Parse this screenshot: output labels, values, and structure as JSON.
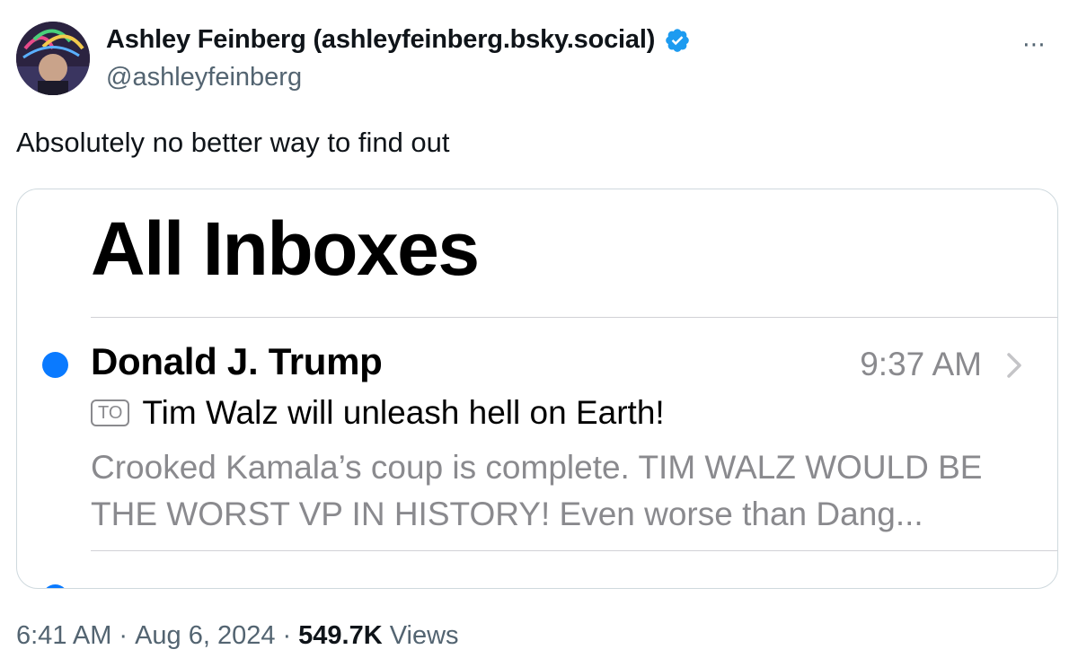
{
  "author": {
    "display_name": "Ashley Feinberg (ashleyfeinberg.bsky.social)",
    "handle": "@ashleyfeinberg",
    "verified_color": "#1d9bf0"
  },
  "more_icon": "⋯",
  "tweet": {
    "text": "Absolutely no better way to find out"
  },
  "media": {
    "title": "All Inboxes",
    "emails": [
      {
        "sender": "Donald J. Trump",
        "time": "9:37 AM",
        "to_badge": "TO",
        "subject": "Tim Walz will unleash hell on Earth!",
        "preview": "Crooked Kamala’s coup is complete. TIM WALZ WOULD BE THE WORST VP IN HISTORY! Even worse than Dang..."
      }
    ],
    "accent": "#0a7aff"
  },
  "footer": {
    "time": "6:41 AM",
    "date": "Aug 6, 2024",
    "views_count": "549.7K",
    "views_label": "Views",
    "separator": "·"
  }
}
